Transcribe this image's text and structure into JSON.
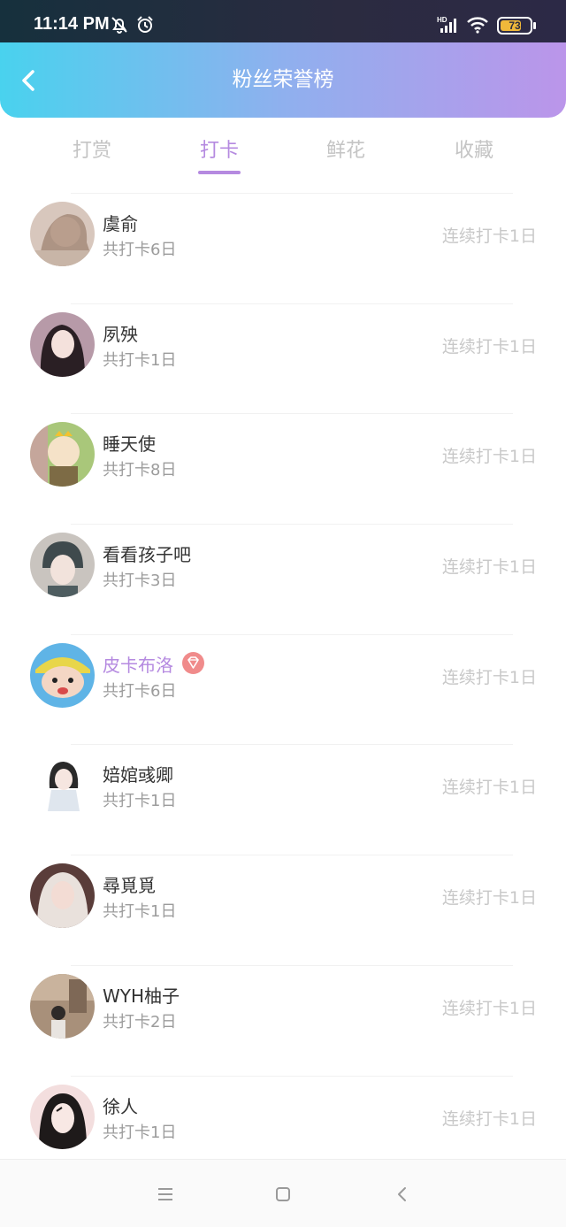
{
  "status_bar": {
    "time": "11:14 PM",
    "battery": "73",
    "battery_level_percent": 73,
    "icons": [
      "mute-bell-icon",
      "alarm-icon",
      "signal-hd-icon",
      "wifi-icon",
      "battery-icon"
    ]
  },
  "header": {
    "title": "粉丝荣誉榜",
    "back_icon": "chevron-left-icon"
  },
  "tabs": [
    {
      "label": "打赏",
      "active": false
    },
    {
      "label": "打卡",
      "active": true
    },
    {
      "label": "鲜花",
      "active": false
    },
    {
      "label": "收藏",
      "active": false
    }
  ],
  "list": [
    {
      "name": "虞俞",
      "total": "共打卡6日",
      "streak": "连续打卡1日",
      "vip": false
    },
    {
      "name": "夙殃",
      "total": "共打卡1日",
      "streak": "连续打卡1日",
      "vip": false
    },
    {
      "name": "睡天使",
      "total": "共打卡8日",
      "streak": "连续打卡1日",
      "vip": false
    },
    {
      "name": "看看孩子吧",
      "total": "共打卡3日",
      "streak": "连续打卡1日",
      "vip": false
    },
    {
      "name": "皮卡布洛",
      "total": "共打卡6日",
      "streak": "连续打卡1日",
      "vip": true
    },
    {
      "name": "婄婠彧卿",
      "total": "共打卡1日",
      "streak": "连续打卡1日",
      "vip": false
    },
    {
      "name": "尋覓覓",
      "total": "共打卡1日",
      "streak": "连续打卡1日",
      "vip": false
    },
    {
      "name": "WYH柚子",
      "total": "共打卡2日",
      "streak": "连续打卡1日",
      "vip": false
    },
    {
      "name": "徐人",
      "total": "共打卡1日",
      "streak": "连续打卡1日",
      "vip": false
    }
  ],
  "nav_bar": {
    "icons": [
      "menu-icon",
      "home-square-icon",
      "back-triangle-icon"
    ]
  },
  "colors": {
    "accent": "#b58ae0",
    "header_gradient_start": "#49d2ee",
    "header_gradient_end": "#bb95ea",
    "vip_badge": "#f08b8b"
  }
}
